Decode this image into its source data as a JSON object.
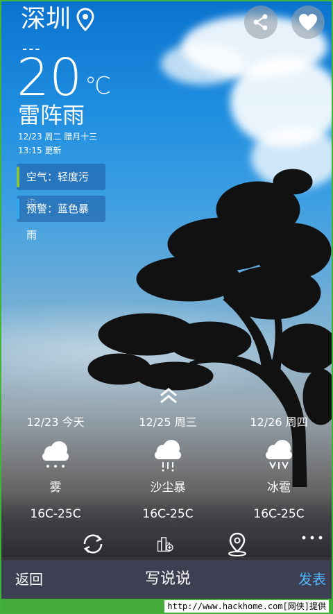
{
  "header": {
    "city": "深圳",
    "dashes": "---",
    "temperature": "20",
    "temp_unit": "℃",
    "condition": "雷阵雨",
    "date_line": "12/23 周二   腊月十三",
    "update_time": "13:15 更新",
    "air_quality": "空气：轻度污染",
    "warning": "预警：蓝色暴雨"
  },
  "colors": {
    "air_bar": "#8bc53f",
    "warn_bar": "#2ea8f0",
    "publish": "#4fb6ff",
    "bottom_bar": "#3d3f52"
  },
  "forecast": [
    {
      "date": "12/23 今天",
      "icon": "fog-cloud-icon",
      "desc": "雾",
      "range": "16C-25C"
    },
    {
      "date": "12/25 周三",
      "icon": "sandstorm-cloud-icon",
      "desc": "沙尘暴",
      "range": "16C-25C"
    },
    {
      "date": "12/26 周四",
      "icon": "hail-cloud-icon",
      "desc": "冰雹",
      "range": "16C-25C"
    }
  ],
  "bottom_bar": {
    "back": "返回",
    "title": "写说说",
    "publish": "发表"
  },
  "watermark": "http://www.hackhome.com[网侠]提供"
}
